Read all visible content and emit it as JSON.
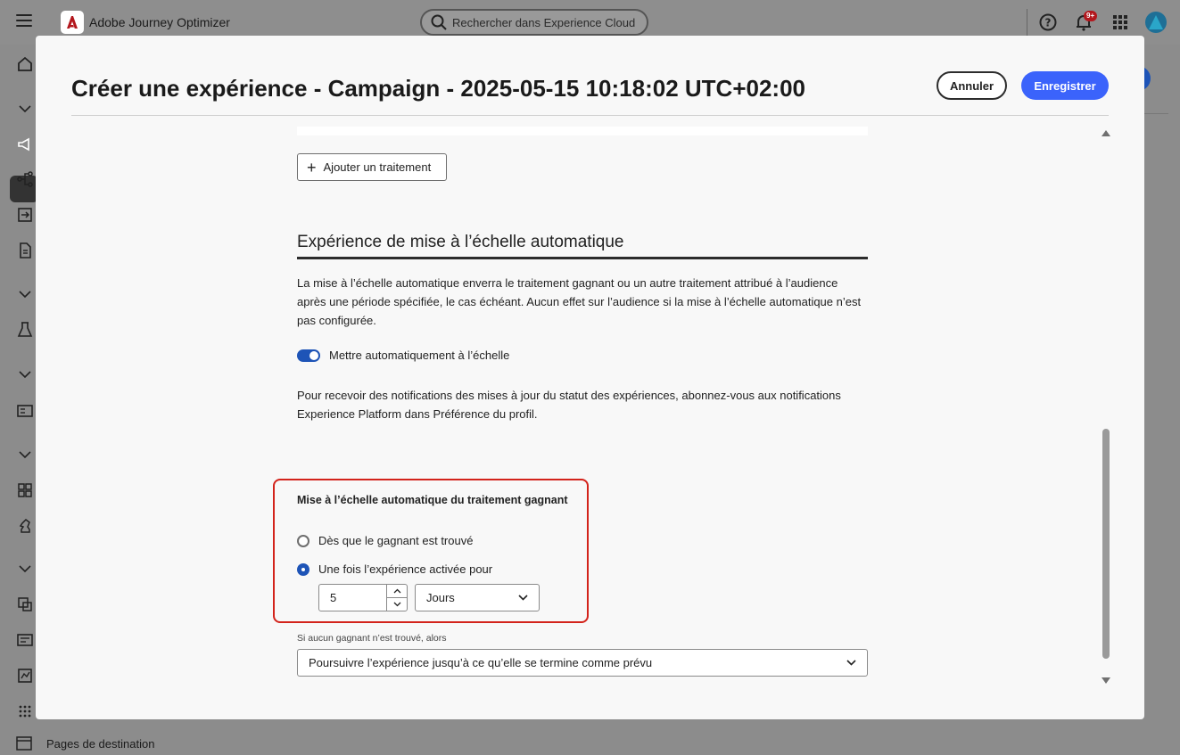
{
  "app": {
    "name": "Adobe Journey Optimizer",
    "search_placeholder": "Rechercher dans Experience Cloud ...",
    "notification_badge": "9+"
  },
  "sidenav": {
    "bottom_item_label": "Pages de destination"
  },
  "modal": {
    "title": "Créer une expérience - Campaign - 2025-05-15 10:18:02 UTC+02:00",
    "cancel_label": "Annuler",
    "save_label": "Enregistrer",
    "add_treatment_label": "Ajouter un traitement",
    "section_heading": "Expérience de mise à l’échelle automatique",
    "description": "La mise à l’échelle automatique enverra le traitement gagnant ou un autre traitement attribué à l’audience après une période spécifiée, le cas échéant. Aucun effet sur l’audience si la mise à l’échelle automatique n’est pas configurée.",
    "toggle_label": "Mettre automatiquement à l’échelle",
    "toggle_on": true,
    "notification_text": "Pour recevoir des notifications des mises à jour du statut des expériences, abonnez-vous aux notifications Experience Platform dans Préférence du profil.",
    "winner_section_title": "Mise à l’échelle automatique du traitement gagnant",
    "radio_options": [
      {
        "label": "Dès que le gagnant est trouvé",
        "checked": false
      },
      {
        "label": "Une fois l’expérience activée pour",
        "checked": true
      }
    ],
    "duration_value": "5",
    "duration_unit": "Jours",
    "fallback_label": "Si aucun gagnant n’est trouvé, alors",
    "fallback_value": "Poursuivre l’expérience jusqu’à ce qu’elle se termine comme prévu"
  },
  "colors": {
    "accent": "#3b63fb",
    "toggle": "#1e54b7",
    "highlight": "#d3231b"
  }
}
